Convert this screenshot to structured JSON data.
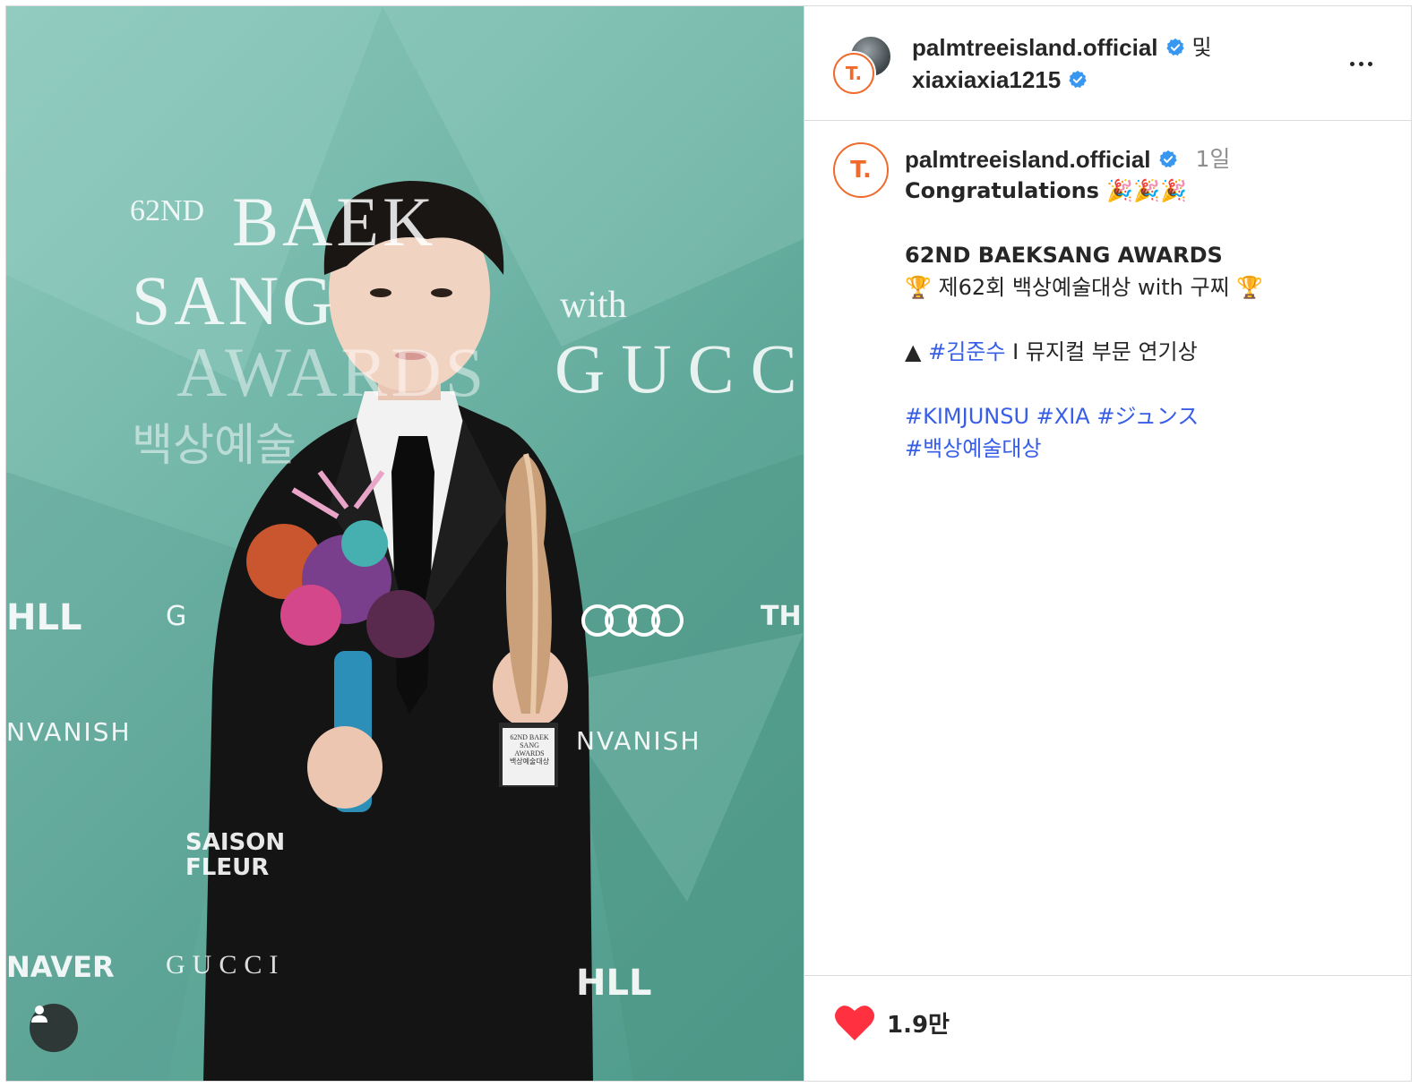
{
  "post": {
    "photo": {
      "backdrop_title_lines": [
        "62ND",
        "BAEK",
        "SANG",
        "AWARDS",
        "with",
        "GUCCI",
        "백상예술"
      ],
      "sponsors": [
        "HLL",
        "G",
        "THE",
        "NVANISH",
        "SAISON FLEUR",
        "NAVER",
        "GUCCI"
      ],
      "trophy_plate": [
        "62ND BAEK",
        "SANG",
        "AWARDS",
        "백상예술대상"
      ],
      "tag_user_icon": "user-tag-icon"
    },
    "header": {
      "user1": "palmtreeisland.official",
      "and": "및",
      "user2": "xiaxiaxia1215",
      "more_icon": "more-horizontal-icon"
    },
    "caption": {
      "username": "palmtreeisland.official",
      "time": "1일",
      "line1": "Congratulations 🎉🎉🎉",
      "line2": "62ND BAEKSANG AWARDS",
      "line3": "🏆 제62회 백상예술대상 with 구찌 🏆",
      "line4_prefix": "▲ ",
      "line4_tag": "#김준수",
      "line4_suffix": " I 뮤지컬 부문 연기상",
      "tags": [
        "#KIMJUNSU",
        "#XIA",
        "#ジュンス"
      ],
      "tag_last": "#백상예술대상"
    },
    "footer": {
      "likes": "1.9만",
      "heart_icon": "heart-filled-icon"
    },
    "colors": {
      "brand_orange": "#f06a2c",
      "verified_blue": "#3897f0",
      "hashtag_blue": "#385ee8",
      "heart_red": "#ff3040"
    }
  }
}
